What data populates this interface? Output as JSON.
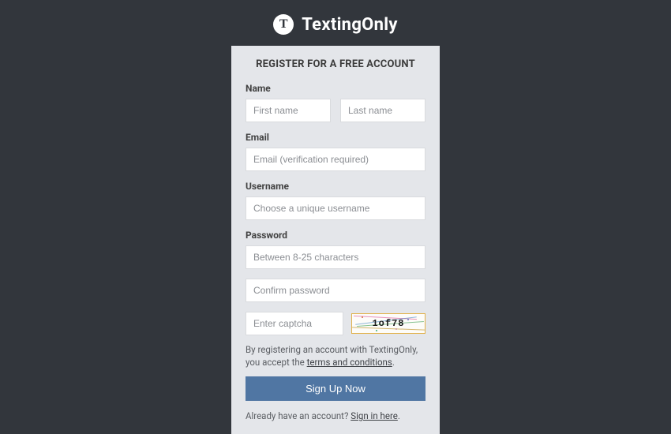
{
  "brand": {
    "name": "TextingOnly",
    "logo_letter": "T"
  },
  "card": {
    "title": "REGISTER FOR A FREE ACCOUNT"
  },
  "form": {
    "name": {
      "label": "Name",
      "first_placeholder": "First name",
      "last_placeholder": "Last name"
    },
    "email": {
      "label": "Email",
      "placeholder": "Email (verification required)"
    },
    "username": {
      "label": "Username",
      "placeholder": "Choose a unique username"
    },
    "password": {
      "label": "Password",
      "placeholder": "Between 8-25 characters",
      "confirm_placeholder": "Confirm password"
    },
    "captcha": {
      "placeholder": "Enter captcha",
      "value": "1of78"
    },
    "terms": {
      "prefix": "By registering an account with TextingOnly, you accept the ",
      "link": "terms and conditions",
      "suffix": "."
    },
    "submit": "Sign Up Now",
    "signin": {
      "prefix": "Already have an account? ",
      "link": "Sign in here",
      "suffix": "."
    }
  }
}
